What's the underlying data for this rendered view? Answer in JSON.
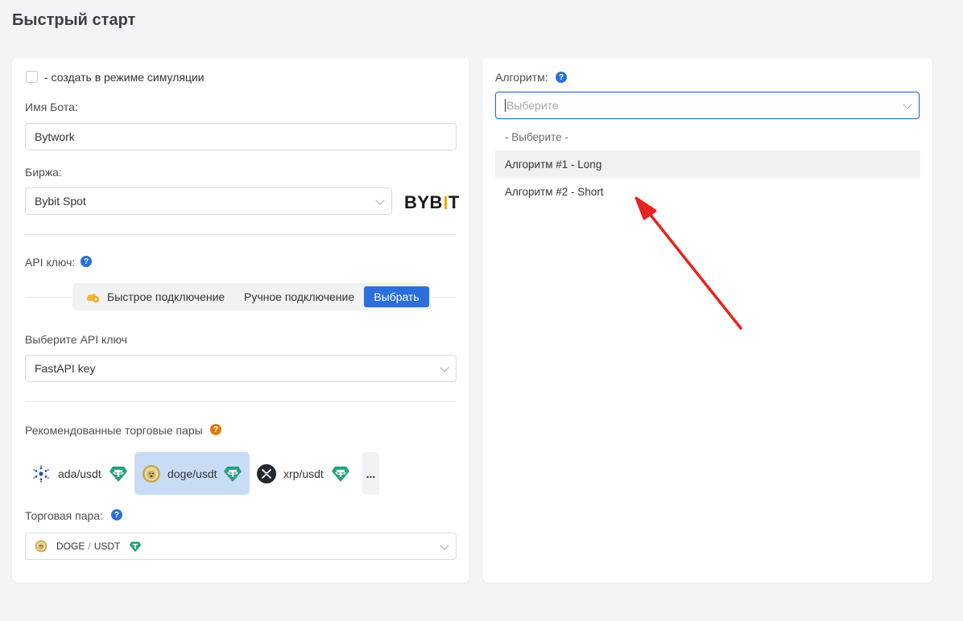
{
  "page": {
    "title": "Быстрый старт"
  },
  "left": {
    "simulation_label": "- создать в режиме симуляции",
    "bot_name_label": "Имя Бота:",
    "bot_name_value": "Bytwork",
    "exchange_label": "Биржа:",
    "exchange_value": "Bybit Spot",
    "exchange_logo": {
      "text_a": "BYB",
      "text_b": "T"
    },
    "api_key_label": "API ключ:",
    "connection_tabs": {
      "quick": "Быстрое подключение",
      "manual": "Ручное подключение",
      "select": "Выбрать"
    },
    "select_api_key_label": "Выберите API ключ",
    "api_key_value": "FastAPI key",
    "recommended_pairs_label": "Рекомендованные торговые пары",
    "pairs": [
      {
        "label": "ada/usdt",
        "icon": "cardano-icon"
      },
      {
        "label": "doge/usdt",
        "icon": "dogecoin-icon"
      },
      {
        "label": "xrp/usdt",
        "icon": "xrp-icon"
      }
    ],
    "more_label": "...",
    "trading_pair_label": "Торговая пара:",
    "trading_pair": {
      "base": "DOGE",
      "sep": "/",
      "quote": "USDT"
    }
  },
  "right": {
    "algorithm_label": "Алгоритм:",
    "algorithm_placeholder": "Выберите",
    "options": [
      "- Выберите -",
      "Алгоритм #1 - Long",
      "Алгоритм #2 - Short"
    ]
  },
  "help_mark": "?",
  "colors": {
    "accent": "#2b6fdc",
    "selected_pair_bg": "#c8dcf6",
    "tether": "#26a17b",
    "arrow": "#e8231f",
    "bybit_bar": "#f7a600"
  }
}
